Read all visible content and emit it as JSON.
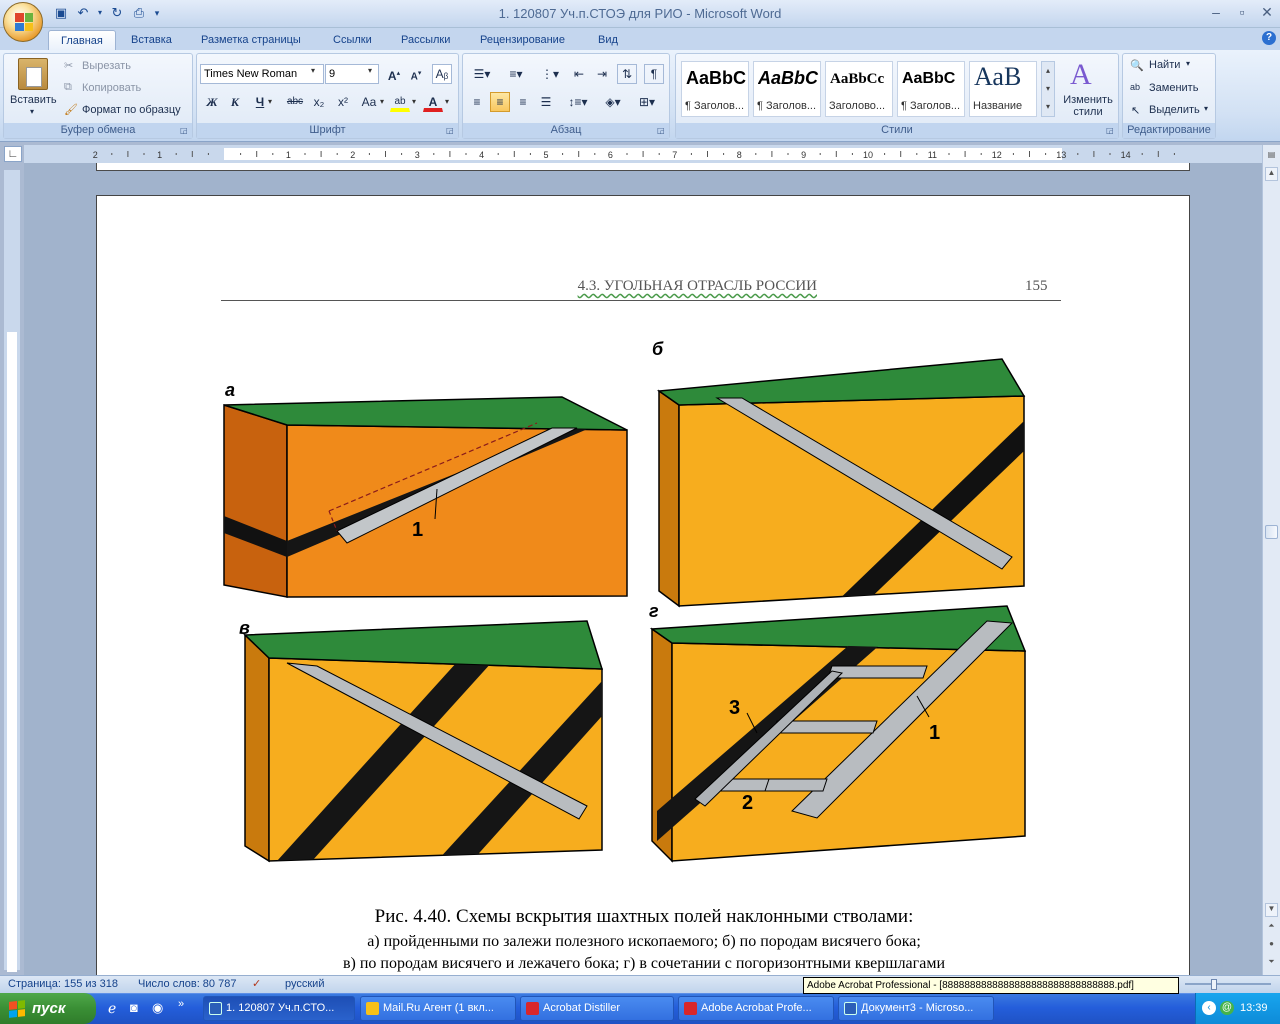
{
  "window": {
    "title": "1. 120807 Уч.п.СТОЭ для РИО - Microsoft Word"
  },
  "ribbon_tabs": [
    "Главная",
    "Вставка",
    "Разметка страницы",
    "Ссылки",
    "Рассылки",
    "Рецензирование",
    "Вид"
  ],
  "clipboard": {
    "paste": "Вставить",
    "cut": "Вырезать",
    "copy": "Копировать",
    "format_painter": "Формат по образцу",
    "group": "Буфер обмена"
  },
  "font": {
    "name": "Times New Roman",
    "size": "9",
    "group": "Шрифт",
    "bold": "Ж",
    "italic": "К",
    "underline": "Ч",
    "strike": "abc",
    "subscript": "x₂",
    "superscript": "x²",
    "case": "Aa"
  },
  "paragraph": {
    "group": "Абзац"
  },
  "styles": {
    "group": "Стили",
    "tiles": [
      {
        "sample": "AaBbC",
        "name": "¶ Заголов..."
      },
      {
        "sample": "AaBbC",
        "name": "¶ Заголов..."
      },
      {
        "sample": "AaBbCc",
        "name": "Заголово..."
      },
      {
        "sample": "AaBbC",
        "name": "¶ Заголов..."
      },
      {
        "sample": "АаВ",
        "name": "Название"
      }
    ],
    "change": "Изменить стили"
  },
  "editing": {
    "group": "Редактирование",
    "find": "Найти",
    "replace": "Заменить",
    "select": "Выделить"
  },
  "document": {
    "running_head": "4.3. УГОЛЬНАЯ ОТРАСЛЬ РОССИИ",
    "page_number": "155",
    "panel_labels": [
      "а",
      "б",
      "в",
      "г"
    ],
    "callouts": [
      "1",
      "1",
      "3",
      "2"
    ],
    "caption_title": "Рис. 4.40. Схемы вскрытия шахтных полей наклонными стволами:",
    "caption_line1": "а) пройденными по залежи полезного ископаемого; б) по породам висячего бока;",
    "caption_line2": "в) по породам висячего и лежачего бока; г) в сочетании с погоризонтными квершлагами"
  },
  "status": {
    "page": "Страница: 155 из 318",
    "words": "Число слов: 80 787",
    "language": "русский"
  },
  "taskbar": {
    "start": "пуск",
    "tasks": [
      "1. 120807 Уч.п.СТО...",
      "Mail.Ru Агент (1 вкл...",
      "Acrobat Distiller",
      "Adobe Acrobat Profe...",
      "Документ3 - Microso..."
    ],
    "clock": "13:39",
    "tooltip": "Adobe Acrobat Professional - [8888888888888888888888888888888.pdf]"
  },
  "colors": {
    "block_face_a": "#f08a1a",
    "block_face": "#f7ad1e",
    "top_green": "#2e8a3a",
    "seam": "#1a1a1a",
    "shaft": "#b8bcc0"
  }
}
